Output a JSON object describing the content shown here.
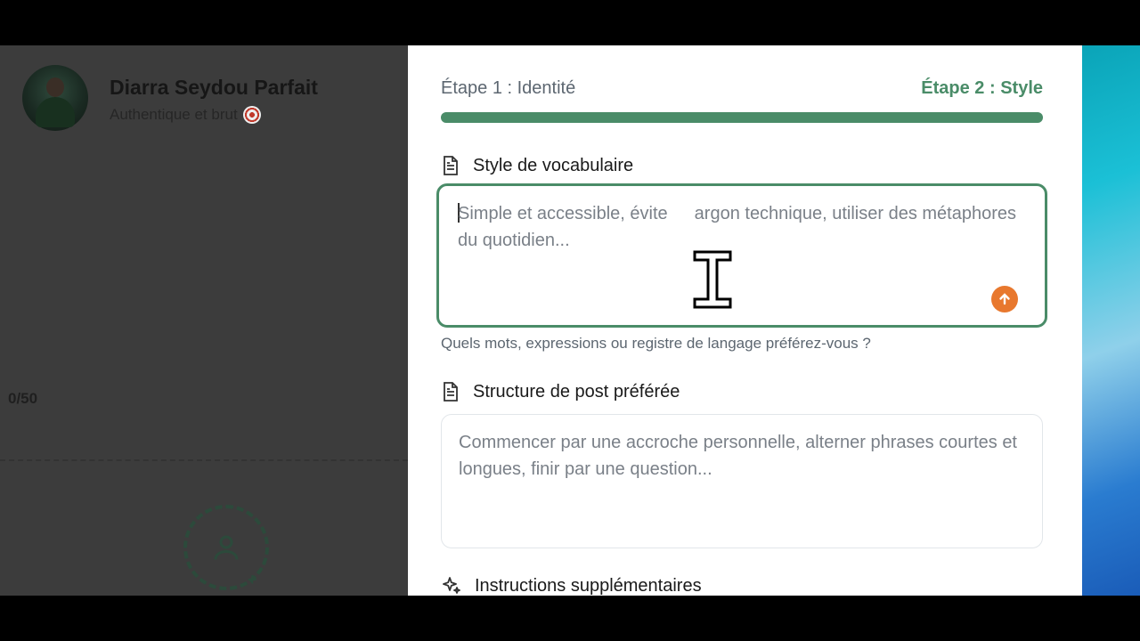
{
  "background_page": {
    "profile_name": "Diarra Seydou Parfait",
    "profile_subtitle": "Authentique et brut",
    "counter": "0/50"
  },
  "modal": {
    "step1_label": "Étape 1 : Identité",
    "step2_label": "Étape 2 : Style",
    "progress": 1.0,
    "accent_color": "#4a8c68",
    "vocab": {
      "label": "Style de vocabulaire",
      "placeholder": "Simple et accessible, éviter le jargon technique, utiliser des métaphores du quotidien...",
      "placeholder_visible": "Simple et accessible, évite",
      "placeholder_visible2": "argon technique, utiliser des métaphores du quotidien...",
      "value": "",
      "hint": "Quels mots, expressions ou registre de langage préférez-vous ?"
    },
    "structure": {
      "label": "Structure de post préférée",
      "placeholder": "Commencer par une accroche personnelle, alterner phrases courtes et longues, finir par une question...",
      "value": ""
    },
    "instructions": {
      "label": "Instructions supplémentaires"
    }
  }
}
